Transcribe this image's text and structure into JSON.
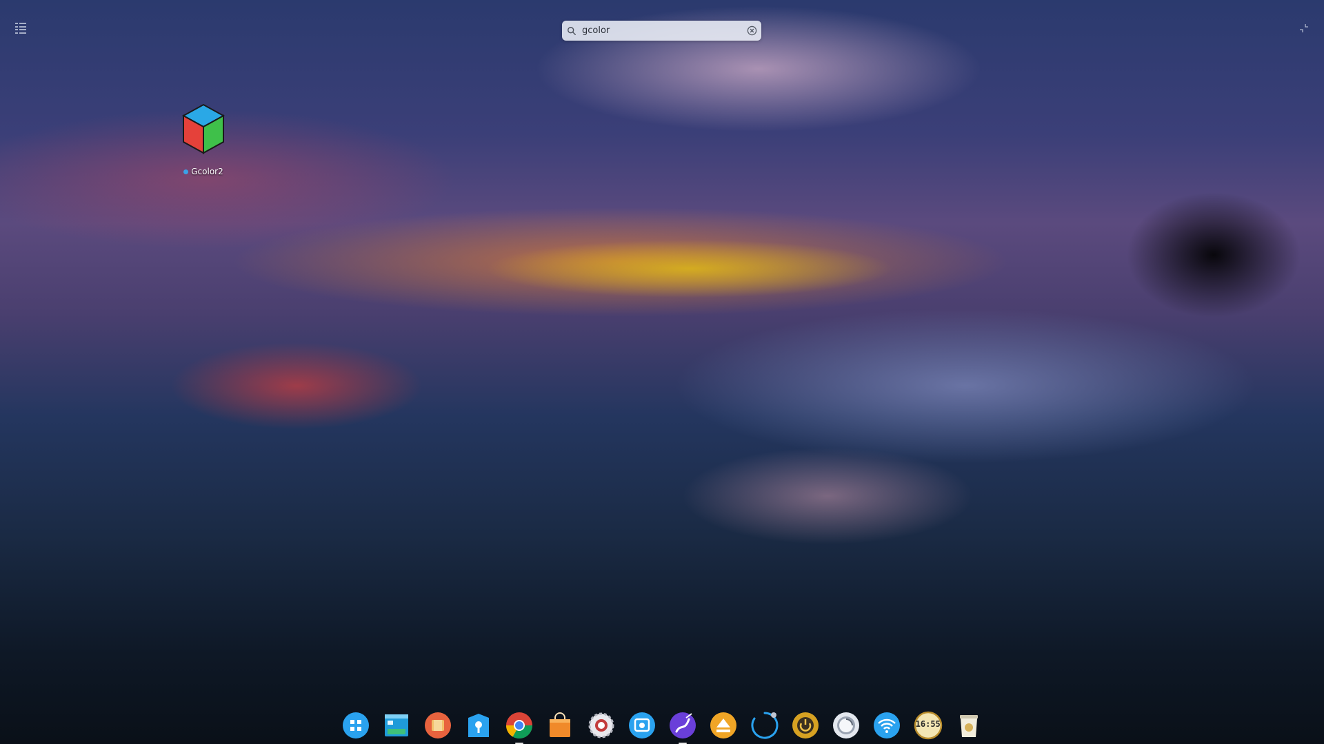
{
  "launcher": {
    "search": {
      "value": "gcolor",
      "icon": "search-icon",
      "clear_icon": "clear-icon"
    },
    "results": [
      {
        "label": "Gcolor2",
        "icon": "gcolor2-cube-icon",
        "is_new": true
      }
    ],
    "mode_toggle_icon": "category-grid-icon",
    "exit_fullscreen_icon": "exit-fullscreen-icon"
  },
  "dock": {
    "items": [
      {
        "name": "launcher",
        "icon": "launcher-icon"
      },
      {
        "name": "multitasking",
        "icon": "multitasking-icon"
      },
      {
        "name": "file-manager",
        "icon": "file-manager-icon"
      },
      {
        "name": "app-store",
        "icon": "app-store-icon"
      },
      {
        "name": "chrome",
        "icon": "chrome-icon",
        "running": true
      },
      {
        "name": "shopping",
        "icon": "shopping-bag-icon"
      },
      {
        "name": "settings",
        "icon": "settings-gear-icon"
      },
      {
        "name": "screenshot",
        "icon": "screenshot-icon"
      },
      {
        "name": "draw",
        "icon": "draw-app-icon",
        "running": true
      },
      {
        "name": "eject",
        "icon": "eject-icon"
      },
      {
        "name": "loading",
        "icon": "spinner-icon"
      },
      {
        "name": "power",
        "icon": "power-icon"
      },
      {
        "name": "quick-settings",
        "icon": "toggle-icon"
      },
      {
        "name": "wifi",
        "icon": "wifi-icon"
      },
      {
        "name": "clock",
        "icon": "clock-icon",
        "time": "16:55"
      },
      {
        "name": "trash",
        "icon": "trash-icon"
      }
    ]
  },
  "colors": {
    "accent": "#2ca7f8",
    "new_dot": "#3aa3e8"
  }
}
